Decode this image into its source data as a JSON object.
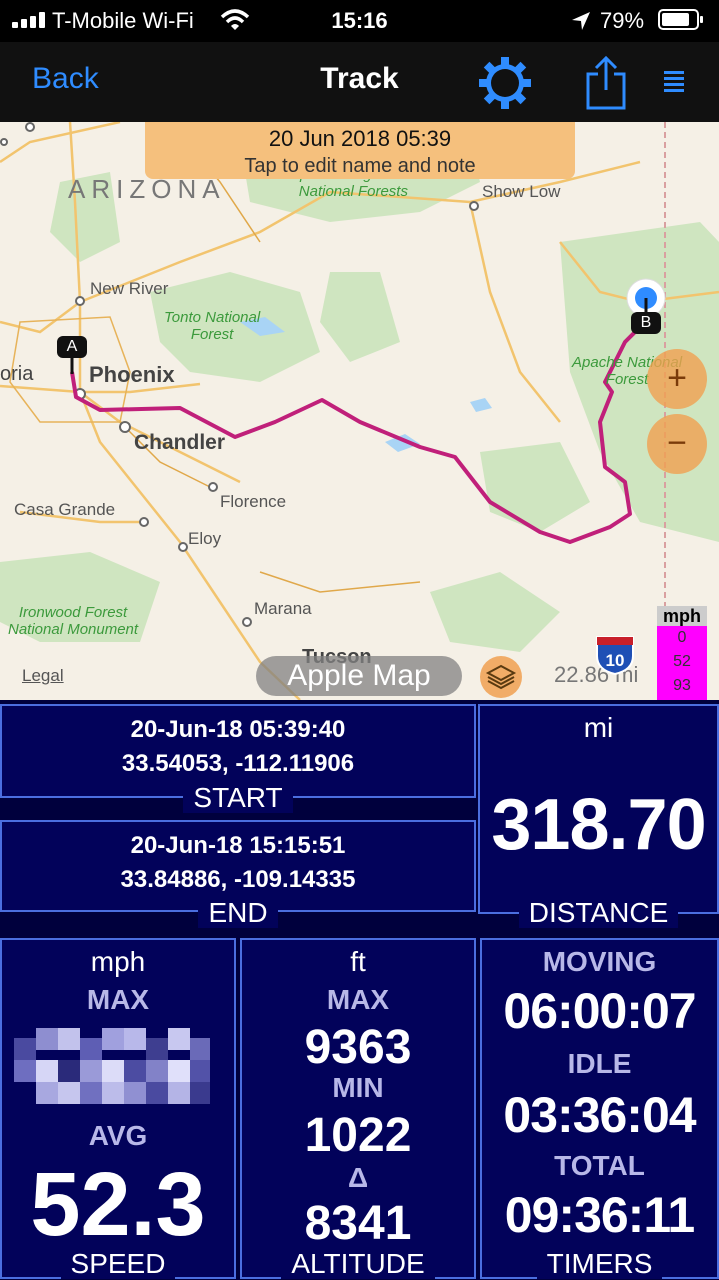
{
  "status_bar": {
    "carrier": "T-Mobile Wi-Fi",
    "time": "15:16",
    "battery_percent": "79%",
    "signal_icon": "signal-bars-icon",
    "wifi_icon": "wifi-icon",
    "location_icon": "location-arrow-icon",
    "battery_icon": "battery-icon"
  },
  "nav": {
    "back_label": "Back",
    "title": "Track",
    "settings_icon": "gear-icon",
    "share_icon": "share-icon",
    "menu_icon": "list-icon",
    "accent_color": "#2f8cff"
  },
  "map": {
    "banner": {
      "title": "20 Jun 2018 05:39",
      "subtitle": "Tap to edit name and note"
    },
    "labels": {
      "arizona": "ARIZONA",
      "apache_sitgreaves": "Apache-Sitgreaves\nNational Forests",
      "show_low": "Show Low",
      "new_river": "New River",
      "tonto": "Tonto National\nForest",
      "oria": "oria",
      "phoenix": "Phoenix",
      "chandler": "Chandler",
      "apache_national": "Apache National\nForest",
      "florence": "Florence",
      "casa_grande": "Casa Grande",
      "eloy": "Eloy",
      "ironwood": "Ironwood Forest\nNational Monument",
      "marana": "Marana",
      "tucson": "Tucson"
    },
    "marker_start": "A",
    "marker_end": "B",
    "zoom_in": "+",
    "zoom_out": "−",
    "map_type_button": "Apple Map",
    "legal_link": "Legal",
    "layers_icon": "layers-icon",
    "scale": "22.86 mi",
    "interstate_shield": "10",
    "speed_legend": {
      "unit": "mph",
      "values": [
        "0",
        "52",
        "93"
      ],
      "color": "#ff00ff"
    },
    "track_color": "#c0207a"
  },
  "start": {
    "datetime": "20-Jun-18 05:39:40",
    "coords": "33.54053, -112.11906",
    "label": "START"
  },
  "end": {
    "datetime": "20-Jun-18 15:15:51",
    "coords": "33.84886, -109.14335",
    "label": "END"
  },
  "distance": {
    "unit": "mi",
    "value": "318.70",
    "label": "DISTANCE"
  },
  "speed": {
    "unit": "mph",
    "max_label": "MAX",
    "avg_label": "AVG",
    "avg_value": "52.3",
    "label": "SPEED"
  },
  "altitude": {
    "unit": "ft",
    "max_label": "MAX",
    "max_value": "9363",
    "min_label": "MIN",
    "min_value": "1022",
    "delta_label": "Δ",
    "delta_value": "8341",
    "label": "ALTITUDE"
  },
  "timers": {
    "moving_label": "MOVING",
    "moving_value": "06:00:07",
    "idle_label": "IDLE",
    "idle_value": "03:36:04",
    "total_label": "TOTAL",
    "total_value": "09:36:11",
    "label": "TIMERS"
  }
}
